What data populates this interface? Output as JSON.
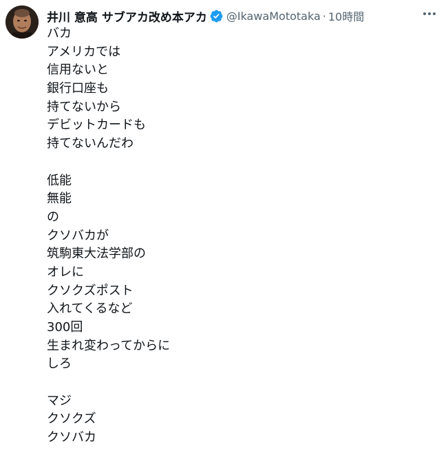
{
  "author": {
    "display_name": "井川 意高 サブアカ改め本アカ",
    "handle": "@IkawaMototaka",
    "separator": "·",
    "time": "10時間",
    "verified": true,
    "verified_color": "#1d9bf0"
  },
  "icons": {
    "avatar": "avatar",
    "verified": "verified-badge-icon",
    "more": "more-options-icon"
  },
  "tweet": {
    "lines": [
      "バカ",
      "アメリカでは",
      "信用ないと",
      "銀行口座も",
      "持てないから",
      "デビットカードも",
      "持てないんだわ",
      "",
      "低能",
      "無能",
      "の",
      "クソバカが",
      "筑駒東大法学部の",
      "オレに",
      "クソクズポスト",
      "入れてくるなど",
      "300回",
      "生まれ変わってからに",
      "しろ",
      "",
      "マジ",
      "クソクズ",
      "クソバカ"
    ]
  }
}
